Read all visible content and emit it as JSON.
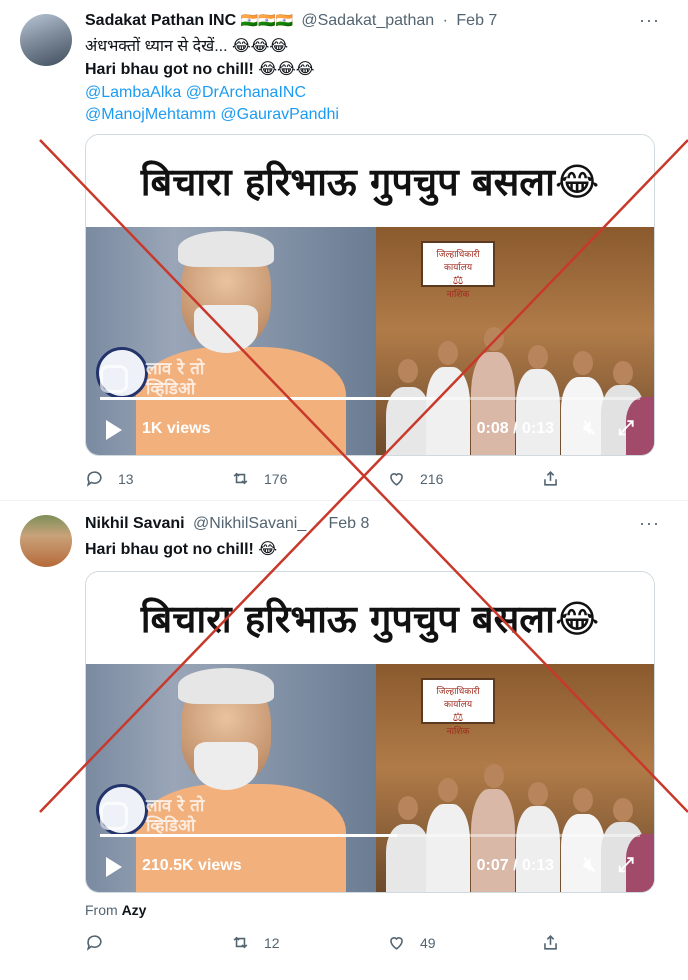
{
  "tweets": [
    {
      "author_name": "Sadakat Pathan INC",
      "author_flags": "🇮🇳🇮🇳🇮🇳",
      "handle": "@Sadakat_pathan",
      "separator": "·",
      "date": "Feb 7",
      "more": "···",
      "line1": "अंधभक्तों ध्यान से देखें... 😂😂😂",
      "line2": "Hari bhau got no chill! 😂😂😂",
      "mentions_line1": "@LambaAlka @DrArchanaINC",
      "mentions_line2": "@ManojMehtamm @GauravPandhi",
      "video": {
        "banner": "बिचारा हरिभाऊ  गुपचुप बसला😂",
        "watermark_line1": "लाव रे तो",
        "watermark_line2": "व्हिडिओ",
        "sign_text_line1": "जिल्हाधिकारी कार्यालय",
        "sign_text_line2": "नाशिक",
        "views": "1K views",
        "time": "0:08 / 0:13",
        "progress": 0.62
      },
      "replies": "13",
      "retweets": "176",
      "likes": "216"
    },
    {
      "author_name": "Nikhil Savani",
      "handle": "@NikhilSavani_",
      "separator": "·",
      "date": "Feb 8",
      "more": "···",
      "line1": "Hari bhau got no chill! 😂",
      "video": {
        "banner": "बिचारा हरिभाऊ  गुपचुप बसला😂",
        "watermark_line1": "लाव रे तो",
        "watermark_line2": "व्हिडिओ",
        "sign_text_line1": "जिल्हाधिकारी कार्यालय",
        "sign_text_line2": "नाशिक",
        "views": "210.5K views",
        "time": "0:07 / 0:13",
        "progress": 0.55
      },
      "from_label": "From",
      "from_source": "Azy",
      "replies": "",
      "retweets": "12",
      "likes": "49"
    }
  ],
  "overlay": {
    "cross_color": "#c8392b"
  },
  "colors": {
    "accent": "#1d9bf0",
    "muted": "#536471"
  }
}
